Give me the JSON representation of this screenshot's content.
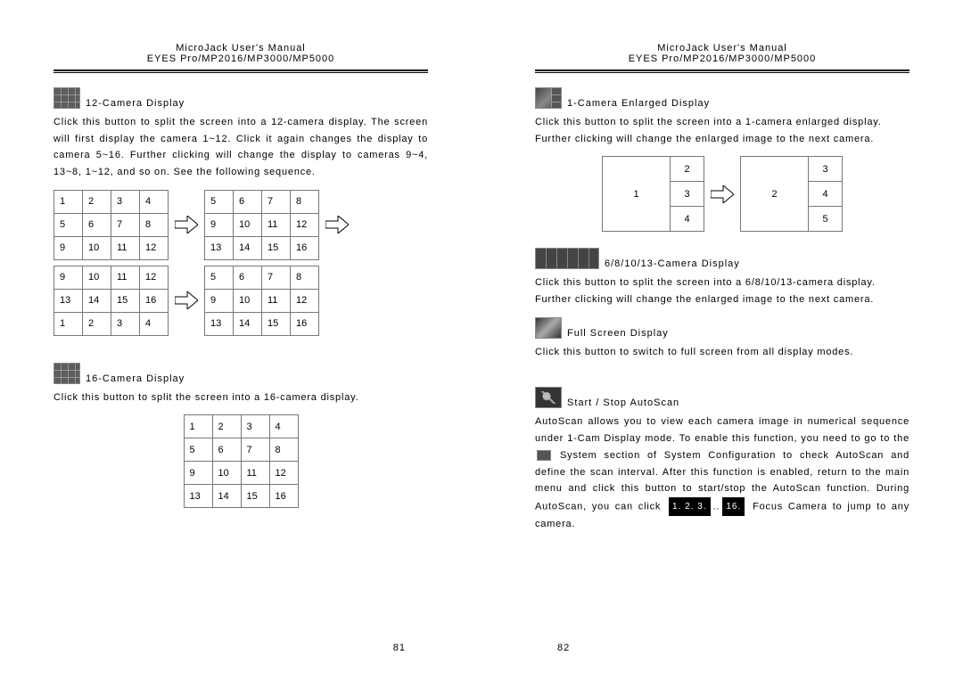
{
  "header": {
    "line1": "MicroJack User's Manual",
    "line2": "EYES Pro/MP2016/MP3000/MP5000"
  },
  "left": {
    "s12": {
      "title": "12-Camera Display",
      "body": "Click this button to split the screen into a 12-camera display.  The screen will first display the camera 1~12.  Click it again changes the display to camera 5~16.  Further clicking will change the display to cameras 9~4, 13~8, 1~12, and so on.  See the following sequence.",
      "grid1": [
        [
          "1",
          "2",
          "3",
          "4"
        ],
        [
          "5",
          "6",
          "7",
          "8"
        ],
        [
          "9",
          "10",
          "11",
          "12"
        ]
      ],
      "grid2": [
        [
          "5",
          "6",
          "7",
          "8"
        ],
        [
          "9",
          "10",
          "11",
          "12"
        ],
        [
          "13",
          "14",
          "15",
          "16"
        ]
      ],
      "grid3": [
        [
          "9",
          "10",
          "11",
          "12"
        ],
        [
          "13",
          "14",
          "15",
          "16"
        ],
        [
          "1",
          "2",
          "3",
          "4"
        ]
      ],
      "grid4": [
        [
          "5",
          "6",
          "7",
          "8"
        ],
        [
          "9",
          "10",
          "11",
          "12"
        ],
        [
          "13",
          "14",
          "15",
          "16"
        ]
      ]
    },
    "s16": {
      "title": "16-Camera Display",
      "body": "Click this button to split the screen into a 16-camera display.",
      "grid": [
        [
          "1",
          "2",
          "3",
          "4"
        ],
        [
          "5",
          "6",
          "7",
          "8"
        ],
        [
          "9",
          "10",
          "11",
          "12"
        ],
        [
          "13",
          "14",
          "15",
          "16"
        ]
      ]
    },
    "pagenum": "81"
  },
  "right": {
    "s1": {
      "title": "1-Camera Enlarged Display",
      "body": "Click this button to split the screen into a 1-camera enlarged display. Further clicking will change the enlarged image to the next camera.",
      "grid1_big": "1",
      "grid1_side": [
        "2",
        "3",
        "4"
      ],
      "grid2_big": "2",
      "grid2_side": [
        "3",
        "4",
        "5"
      ]
    },
    "s68": {
      "title": "6/8/10/13-Camera Display",
      "body": "Click this button to split the screen into a 6/8/10/13-camera display. Further clicking will change the enlarged image to the next camera."
    },
    "full": {
      "title": "Full Screen Display",
      "body": "Click this button to switch to full screen from all display modes."
    },
    "auto": {
      "title": "Start / Stop AutoScan",
      "body1": "AutoScan allows you to view each camera image in numerical sequence under 1-Cam Display mode.  To enable this function, you need to go to the",
      "body2": "System section of System Configuration to check AutoScan and define the scan interval.  After this function is enabled, return to the main menu and click this button to start/stop the AutoScan function. During AutoScan, you can click",
      "focus_labels": "1.  2.  3.",
      "focus_dots": "..",
      "focus_last": "16.",
      "body3": "Focus Camera to jump to any camera."
    },
    "pagenum": "82"
  }
}
